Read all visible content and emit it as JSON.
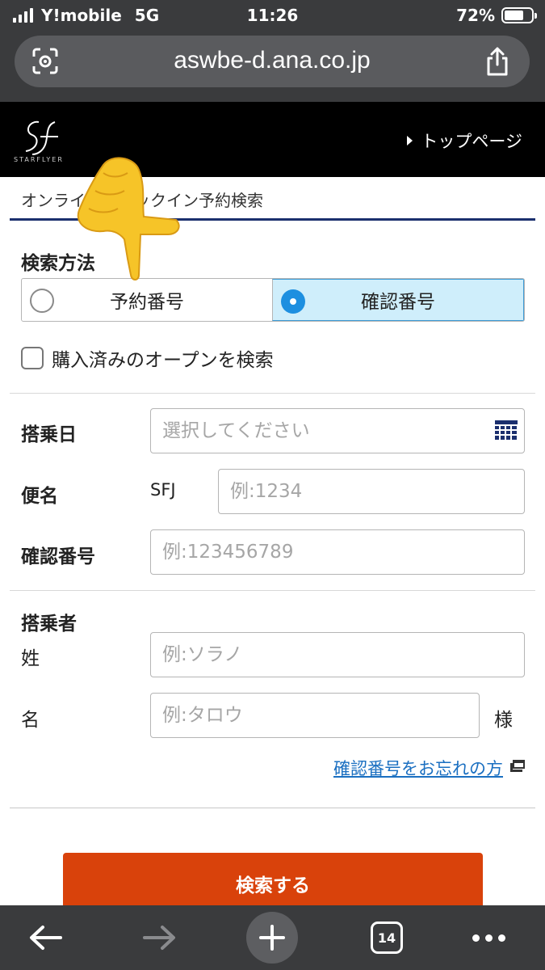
{
  "status_bar": {
    "carrier": "Y!mobile",
    "network": "5G",
    "time": "11:26",
    "battery": "72%",
    "battery_level": 0.72
  },
  "browser": {
    "url": "aswbe-d.ana.co.jp",
    "tab_count": "14",
    "icons": [
      "scan-icon",
      "share-icon",
      "back-arrow-icon",
      "forward-arrow-icon",
      "new-tab-plus-icon",
      "tabs-icon",
      "more-dots-icon"
    ]
  },
  "header": {
    "logo_text": "STARFLYER",
    "top_link": "トップページ",
    "background": "#000000"
  },
  "breadcrumb": "オンラインチェックイン予約検索",
  "search_method": {
    "title": "検索方法",
    "options": [
      "予約番号",
      "確認番号"
    ],
    "selected": "確認番号"
  },
  "open_ticket_checkbox": {
    "label": "購入済みのオープンを検索",
    "checked": false
  },
  "form": {
    "date_label": "搭乗日",
    "date_placeholder": "選択してください",
    "flight_label": "便名",
    "flight_prefix": "SFJ",
    "flight_placeholder": "例:1234",
    "confirmation_label": "確認番号",
    "confirmation_placeholder": "例:123456789"
  },
  "passenger": {
    "title": "搭乗者",
    "surname_label": "姓",
    "surname_placeholder": "例:ソラノ",
    "given_label": "名",
    "given_placeholder": "例:タロウ",
    "honorific": "様"
  },
  "forgot_link": "確認番号をお忘れの方",
  "search_button": "検索する",
  "colors": {
    "accent_navy": "#1b2f6e",
    "search_button": "#d9420b",
    "selected_option_bg": "#cfeefb",
    "radio_selected": "#1d8fe0",
    "link": "#1a6fc1"
  }
}
